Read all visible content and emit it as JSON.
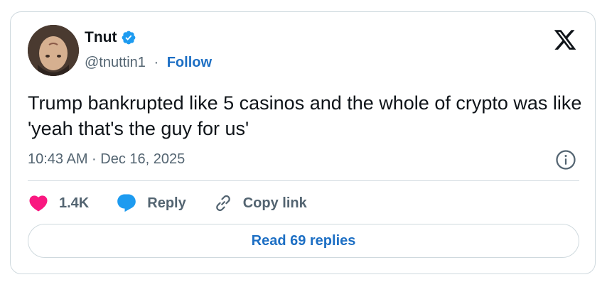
{
  "author": {
    "name": "Tnut",
    "handle": "@tnuttin1",
    "separator": "·",
    "follow_label": "Follow",
    "verified": true,
    "verified_color": "#1d9bf0"
  },
  "tweet": {
    "text": "Trump bankrupted like 5 casinos and the whole of crypto was like 'yeah that's the guy for us'",
    "timestamp": "10:43 AM · Dec 16, 2025"
  },
  "actions": {
    "like_count": "1.4K",
    "reply_label": "Reply",
    "copy_link_label": "Copy link"
  },
  "footer": {
    "read_replies_label": "Read 69 replies"
  },
  "icons": {
    "logo": "x-logo-icon",
    "info": "info-icon",
    "like": "heart-icon",
    "reply": "speech-bubble-icon",
    "copy": "link-icon",
    "verified": "verified-badge-icon"
  },
  "colors": {
    "accent": "#1d6fc4",
    "like": "#f91880",
    "reply": "#1d9bf0",
    "text": "#0f1419",
    "muted": "#536471",
    "border": "#cfd9de"
  }
}
